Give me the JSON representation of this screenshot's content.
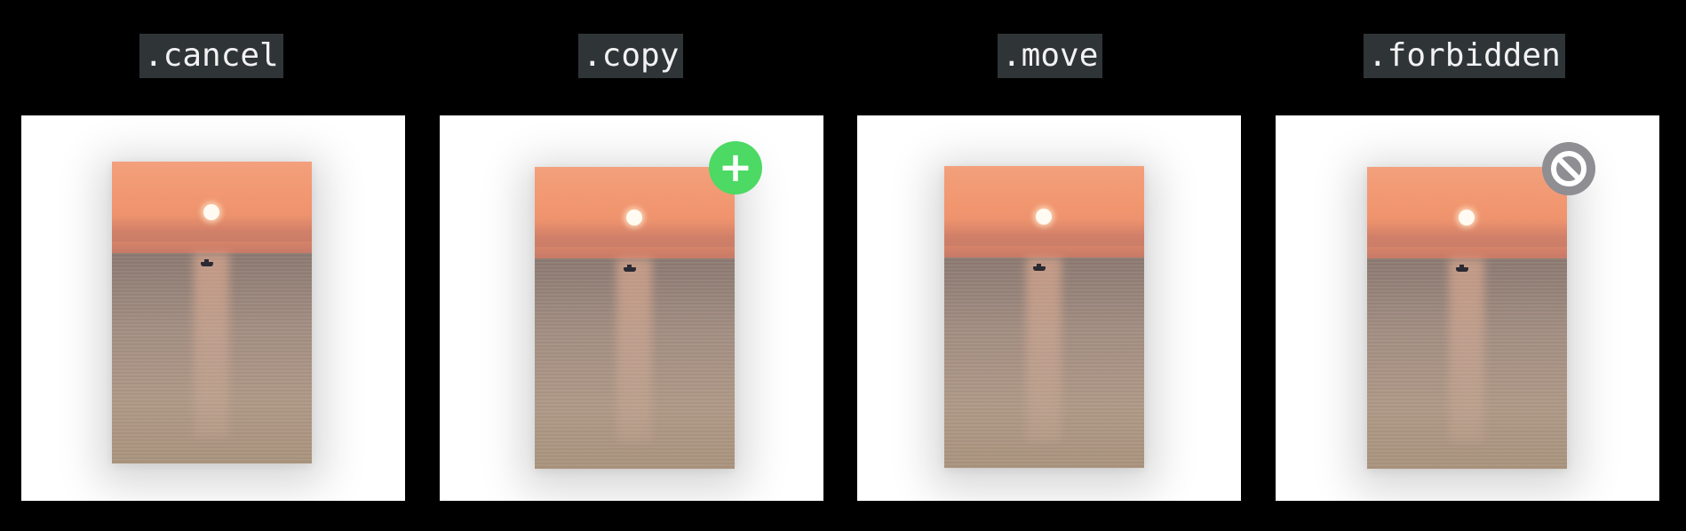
{
  "operations": [
    {
      "label": ".cancel",
      "badge": null
    },
    {
      "label": ".copy",
      "badge": "plus-icon"
    },
    {
      "label": ".move",
      "badge": null
    },
    {
      "label": ".forbidden",
      "badge": "prohibited-icon"
    }
  ],
  "colors": {
    "background": "#000000",
    "label_background": "#2f3437",
    "label_text": "#f2f2f2",
    "panel": "#ffffff",
    "copy_badge": "#4cd964",
    "forbidden_badge": "#8e8e93"
  },
  "badges": {
    "copy_symbol": "+"
  }
}
